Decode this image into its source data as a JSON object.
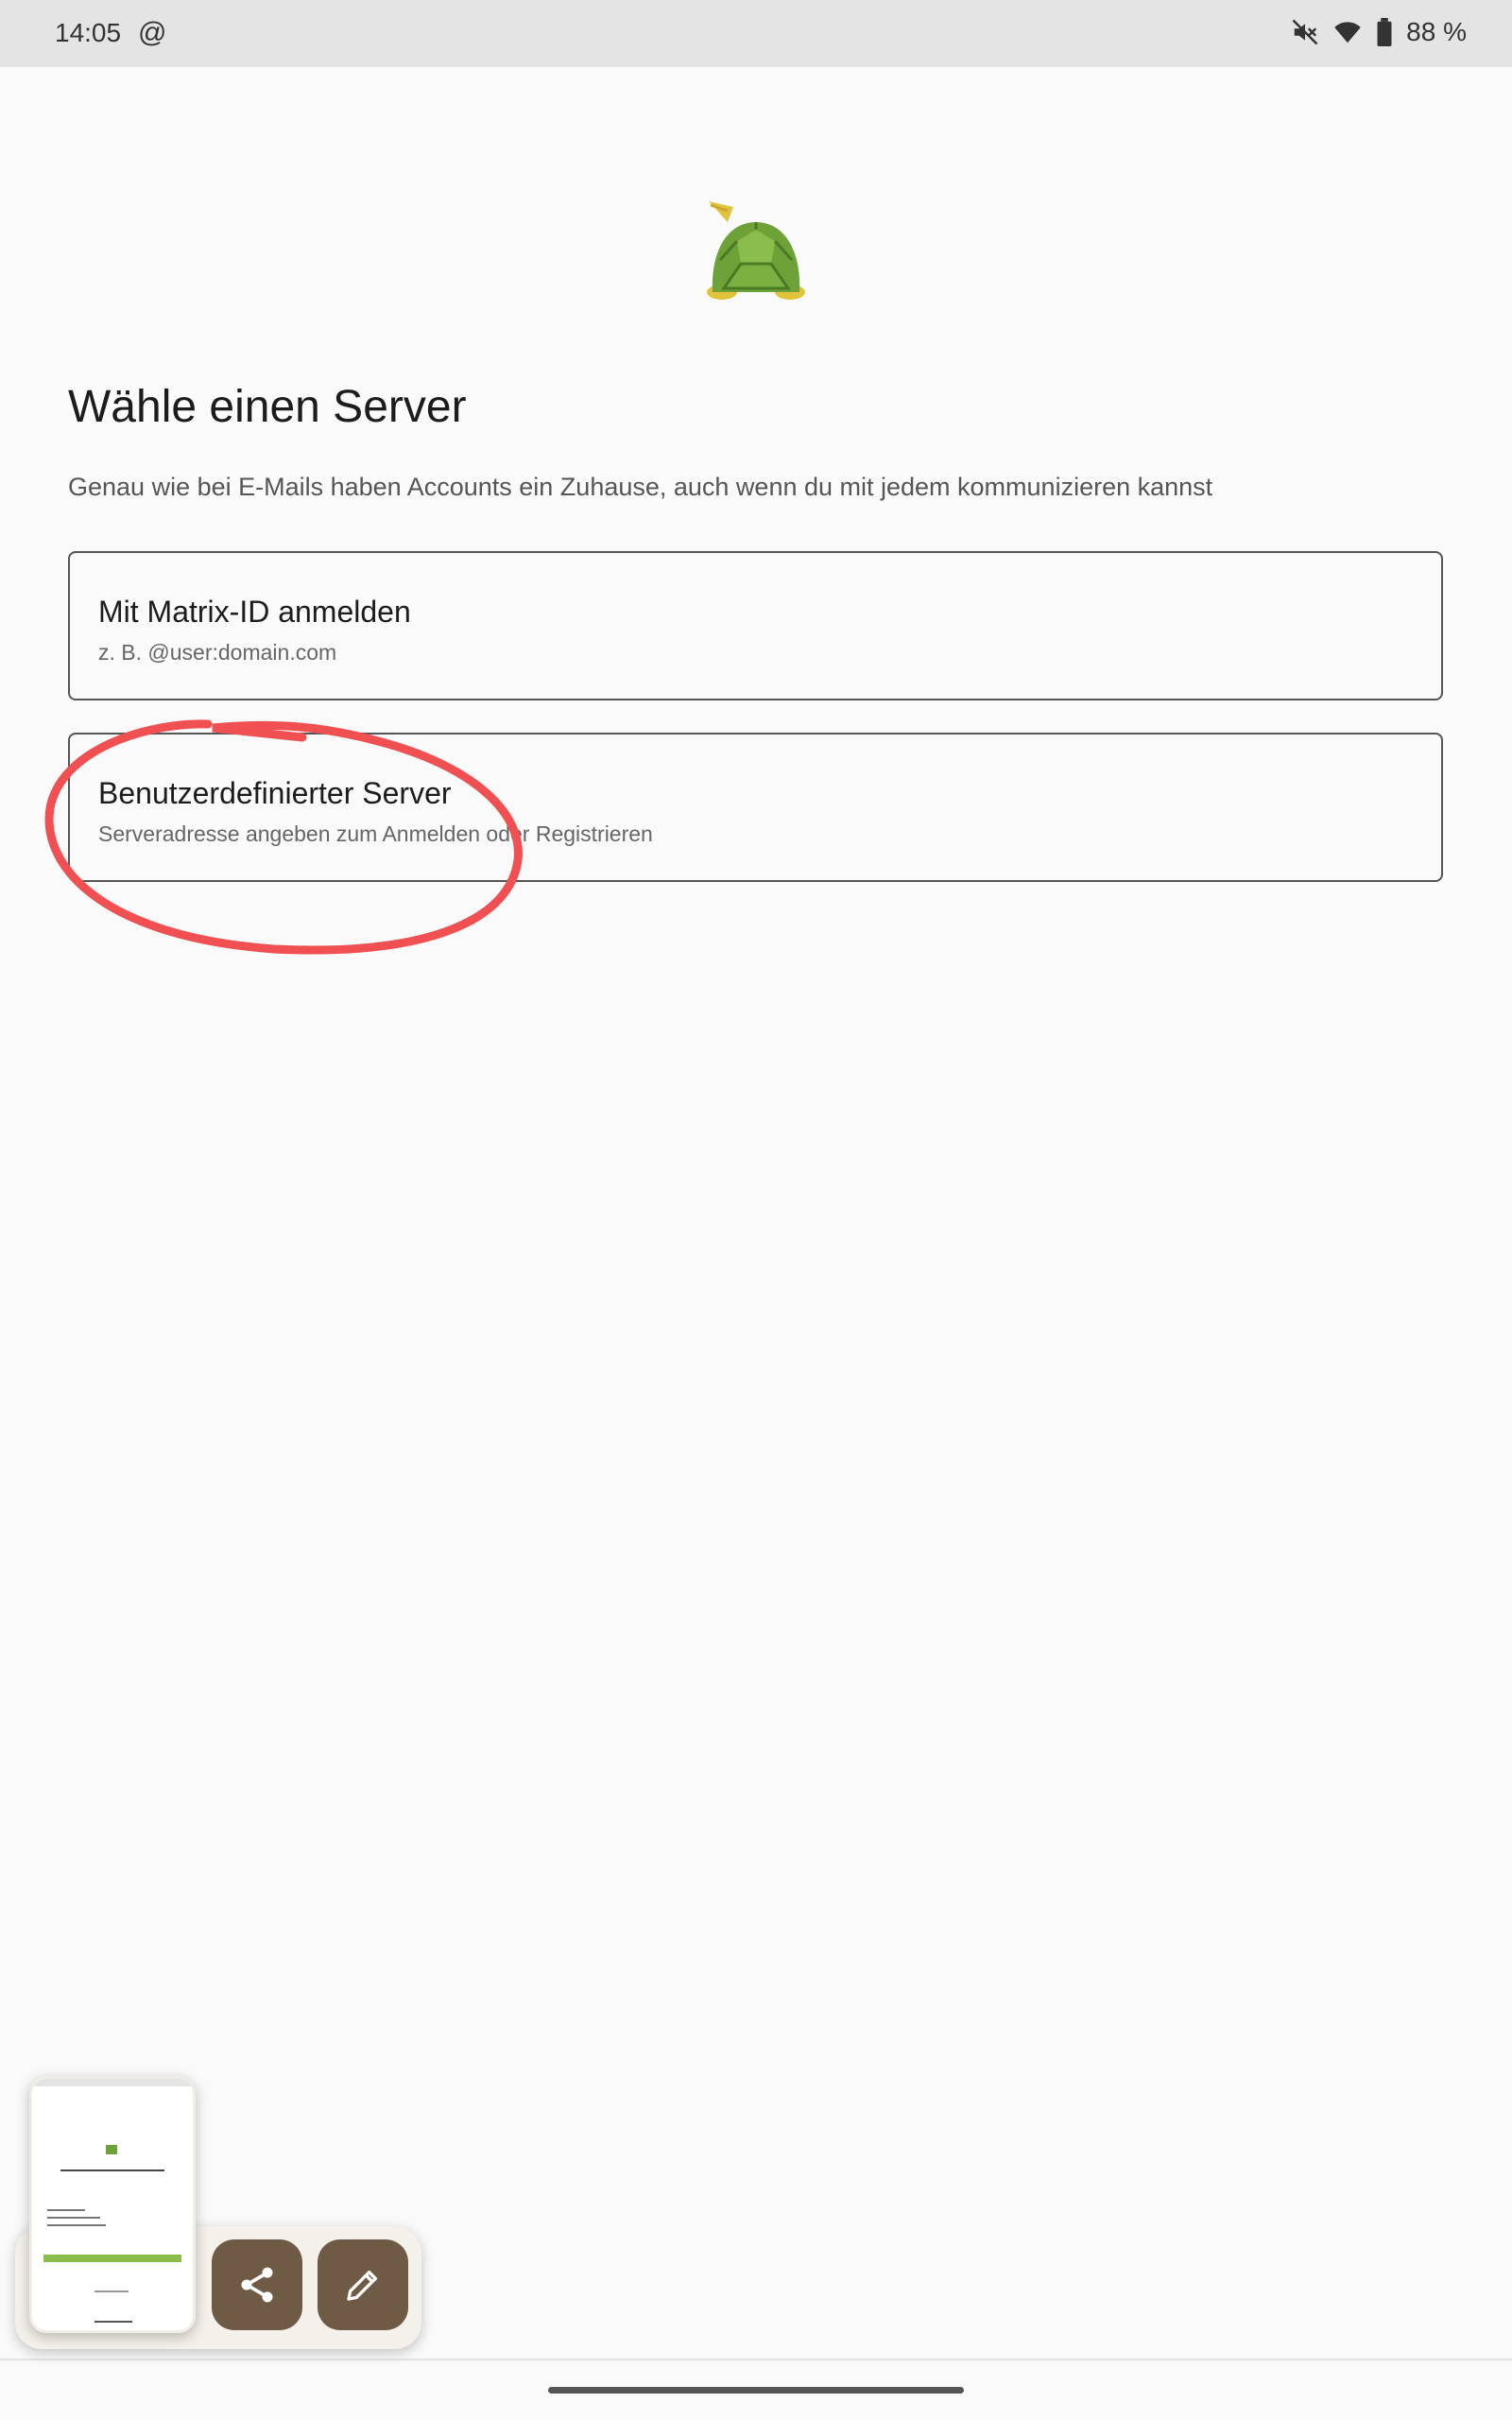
{
  "status_bar": {
    "time": "14:05",
    "at_symbol": "@",
    "battery_text": "88 %",
    "icons": [
      "mute-icon",
      "wifi-icon",
      "battery-icon"
    ]
  },
  "logo": {
    "icon": "turtle-logo-icon"
  },
  "heading": {
    "title": "Wähle einen Server",
    "subtitle": "Genau wie bei E-Mails haben Accounts ein Zuhause, auch wenn du mit jedem kommunizieren kannst"
  },
  "options": [
    {
      "title": "Mit Matrix-ID anmelden",
      "subtitle": "z. B. @user:domain.com"
    },
    {
      "title": "Benutzerdefinierter Server",
      "subtitle": "Serveradresse angeben zum Anmelden oder Registrieren"
    }
  ],
  "screenshot_tray": {
    "share_icon": "share-icon",
    "edit_icon": "pencil-icon"
  },
  "colors": {
    "background": "#fafafa",
    "status_bar": "#e4e4e4",
    "annotation": "#f05052",
    "fab": "#6e5a45",
    "turtle_shell": "#6ea238",
    "turtle_body": "#e0c33a"
  }
}
